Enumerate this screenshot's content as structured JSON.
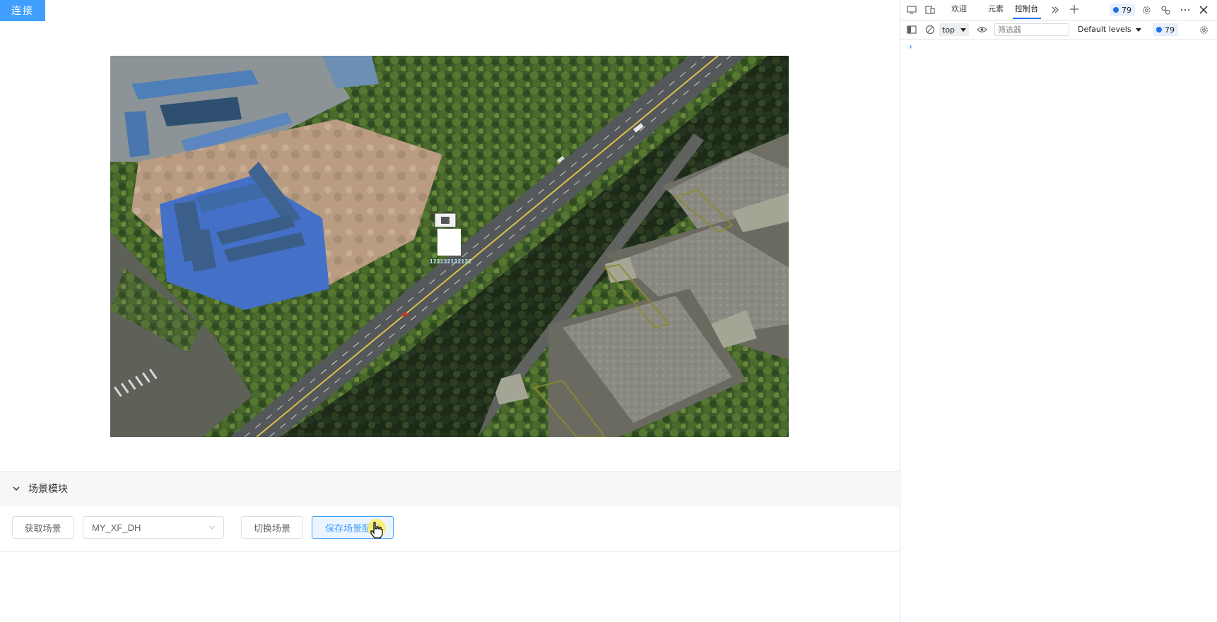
{
  "app": {
    "connect_label": "连接",
    "scene_label_text": "123132132132",
    "collapse": {
      "title": "场景模块",
      "get_scene_label": "获取场景",
      "scene_select_value": "MY_XF_DH",
      "switch_scene_label": "切换场景",
      "save_config_label": "保存场景配置"
    }
  },
  "devtools": {
    "tabs": [
      "欢迎",
      "元素",
      "控制台"
    ],
    "active_tab": "控制台",
    "issues_count": "79",
    "context": "top",
    "filter_placeholder": "筛选器",
    "levels_label": "Default levels",
    "console_badge_count": "79",
    "prompt_symbol": "›"
  },
  "colors": {
    "primary": "#409eff",
    "devtools_accent": "#1a73e8"
  },
  "icons": [
    "chevron-down-icon",
    "screen-cast-icon",
    "device-toggle-icon",
    "more-tabs-icon",
    "add-tab-icon",
    "settings-icon",
    "share-icon",
    "more-options-icon",
    "close-icon",
    "sidebar-toggle-icon",
    "clear-console-icon",
    "eye-icon",
    "caret-down-icon",
    "pointer-cursor-icon"
  ]
}
